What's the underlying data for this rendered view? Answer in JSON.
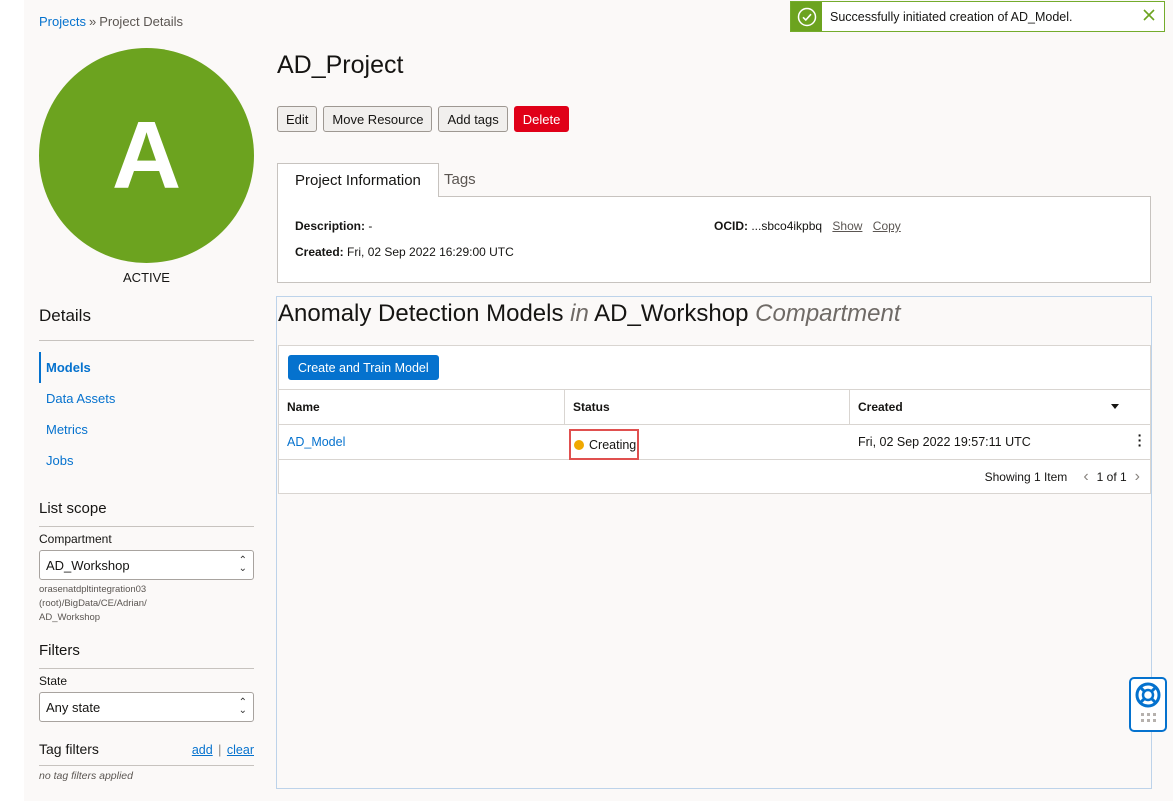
{
  "breadcrumb": {
    "root": "Projects",
    "separator": "»",
    "current": "Project Details"
  },
  "project": {
    "avatar_letter": "A",
    "status": "ACTIVE",
    "title": "AD_Project",
    "actions": {
      "edit": "Edit",
      "move": "Move Resource",
      "tags": "Add tags",
      "delete": "Delete"
    }
  },
  "tabs": {
    "info": "Project Information",
    "tags": "Tags"
  },
  "info": {
    "description_label": "Description:",
    "description_value": "-",
    "created_label": "Created:",
    "created_value": "Fri, 02 Sep 2022 16:29:00 UTC",
    "ocid_label": "OCID:",
    "ocid_value": "...sbco4ikpbq",
    "show": "Show",
    "copy": "Copy"
  },
  "sidebar": {
    "details_title": "Details",
    "items": [
      {
        "label": "Models",
        "active": true
      },
      {
        "label": "Data Assets",
        "active": false
      },
      {
        "label": "Metrics",
        "active": false
      },
      {
        "label": "Jobs",
        "active": false
      }
    ],
    "list_scope_title": "List scope",
    "compartment_label": "Compartment",
    "compartment_value": "AD_Workshop",
    "compartment_path_1": "orasenatdpltintegration03 (root)/BigData/CE/Adrian/",
    "compartment_path_2": "AD_Workshop",
    "filters_title": "Filters",
    "state_label": "State",
    "state_value": "Any state",
    "tag_filters_title": "Tag filters",
    "add": "add",
    "divider": "|",
    "clear": "clear",
    "no_tags": "no tag filters applied"
  },
  "models": {
    "title_main": "Anomaly Detection Models",
    "title_in": "in",
    "title_compartment": "AD_Workshop",
    "title_suffix": "Compartment",
    "create_button": "Create and Train Model",
    "columns": {
      "name": "Name",
      "status": "Status",
      "created": "Created"
    },
    "rows": [
      {
        "name": "AD_Model",
        "status": "Creating",
        "created": "Fri, 02 Sep 2022 19:57:11 UTC"
      }
    ],
    "showing": "Showing 1 Item",
    "page": "1 of 1"
  },
  "toast": {
    "message": "Successfully initiated creation of AD_Model."
  },
  "colors": {
    "accent": "#0572ce",
    "avatar": "#6ca31f",
    "danger": "#e00018",
    "status_creating": "#f0a800"
  }
}
